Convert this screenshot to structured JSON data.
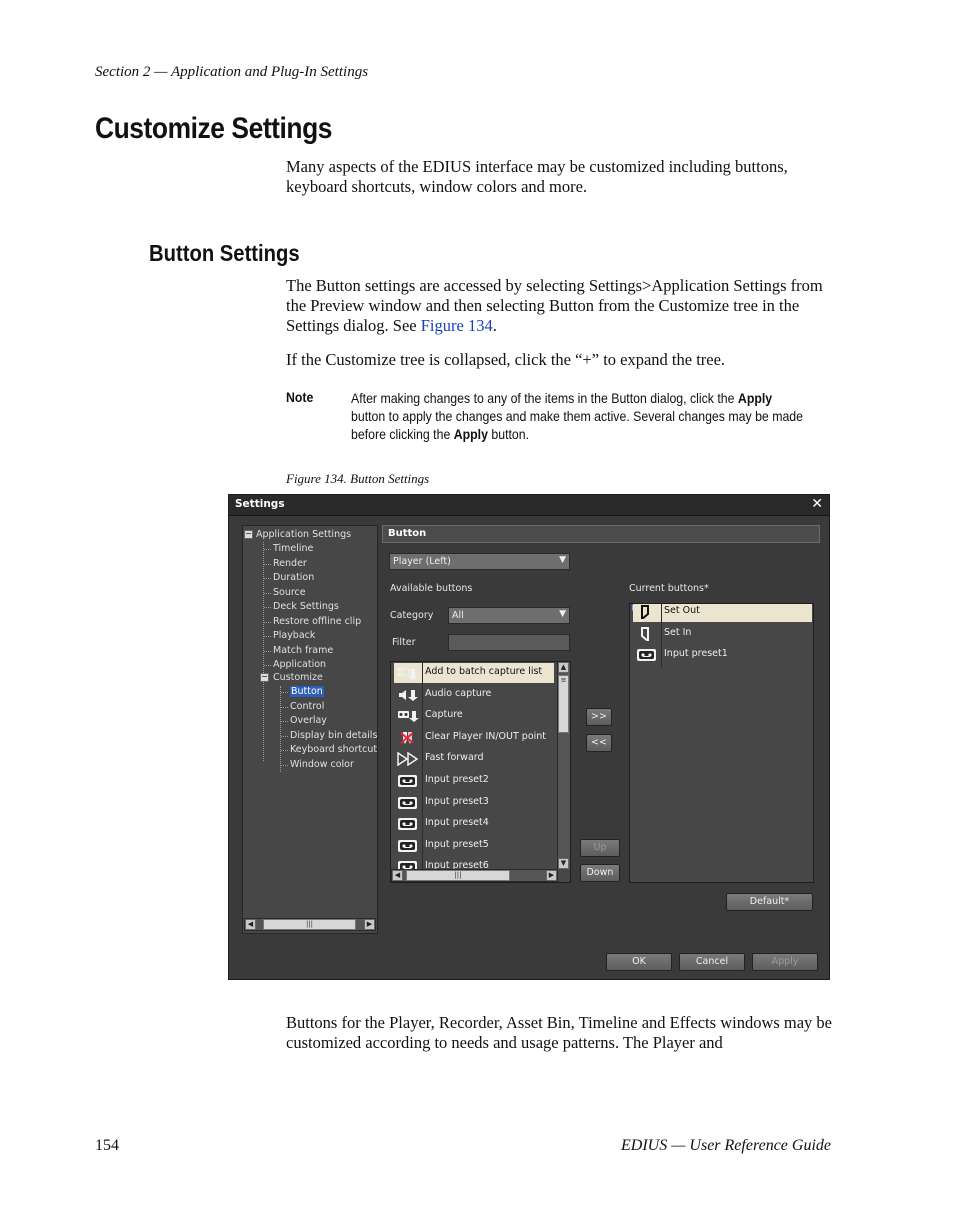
{
  "page": {
    "running_head": "Section 2 — Application and Plug-In Settings",
    "title": "Customize Settings",
    "intro": "Many aspects of the EDIUS interface may be customized including buttons, keyboard shortcuts, window colors and more.",
    "subtitle": "Button Settings",
    "para1_a": "The Button settings are accessed by selecting Settings>Application Settings from the Preview window and then selecting Button from the Customize tree in the Settings dialog. See ",
    "para1_link": "Figure 134",
    "para1_b": ".",
    "para2": "If the Customize tree is collapsed, click the “+” to expand the tree.",
    "note_label": "Note",
    "note_a": "After making changes to any of the items in the Button dialog, click the ",
    "note_apply1": "Apply",
    "note_b": " button to apply the changes and make them active. Several changes may be made before clicking the ",
    "note_apply2": "Apply",
    "note_c": " button.",
    "caption": "Figure 134.  Button Settings",
    "para3": "Buttons for the Player, Recorder, Asset Bin, Timeline and Effects windows may be customized according to needs and usage patterns. The Player and",
    "page_number": "154",
    "footer": "EDIUS  —  User Reference Guide"
  },
  "dialog": {
    "title": "Settings",
    "close": "✕",
    "tree": {
      "root": "Application Settings",
      "root_children": [
        "Timeline",
        "Render",
        "Duration",
        "Source",
        "Deck Settings",
        "Restore offline clip",
        "Playback",
        "Match frame",
        "Application"
      ],
      "customize": "Customize",
      "customize_children": [
        "Button",
        "Control",
        "Overlay",
        "Display bin details",
        "Keyboard shortcut",
        "Window color"
      ],
      "expand_glyph": "−"
    },
    "section_title": "Button",
    "target_select": "Player (Left)",
    "available_label": "Available buttons",
    "category_label": "Category",
    "category_value": "All",
    "filter_label": "Filter",
    "filter_value": "",
    "available": [
      {
        "label": "Add to batch capture list",
        "icon": "batch-capture-icon"
      },
      {
        "label": "Audio capture",
        "icon": "audio-capture-icon"
      },
      {
        "label": "Capture",
        "icon": "capture-icon"
      },
      {
        "label": "Clear Player IN/OUT point",
        "icon": "clear-in-out-icon"
      },
      {
        "label": "Fast forward",
        "icon": "fast-forward-icon"
      },
      {
        "label": "Input preset2",
        "icon": "input-preset-icon"
      },
      {
        "label": "Input preset3",
        "icon": "input-preset-icon"
      },
      {
        "label": "Input preset4",
        "icon": "input-preset-icon"
      },
      {
        "label": "Input preset5",
        "icon": "input-preset-icon"
      },
      {
        "label": "Input preset6",
        "icon": "input-preset-icon"
      }
    ],
    "current_label": "Current buttons*",
    "current": [
      {
        "label": "Set Out",
        "icon": "set-out-icon"
      },
      {
        "label": "Set In",
        "icon": "set-in-icon"
      },
      {
        "label": "Input preset1",
        "icon": "input-preset-icon"
      }
    ],
    "add_button": ">>",
    "remove_button": "<<",
    "up_button": "Up",
    "down_button": "Down",
    "default_button": "Default*",
    "ok_button": "OK",
    "cancel_button": "Cancel",
    "apply_button": "Apply",
    "scroll_thumb": "|||"
  }
}
